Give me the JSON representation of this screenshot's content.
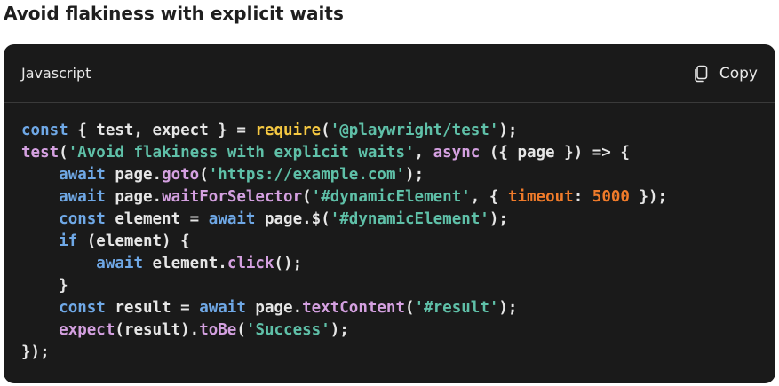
{
  "heading": "Avoid flakiness with explicit waits",
  "code_block": {
    "language": "Javascript",
    "copy_label": "Copy",
    "copy_icon": "copy-icon",
    "lines": [
      [
        {
          "t": "const",
          "c": "k"
        },
        {
          "t": " { test, expect } = "
        },
        {
          "t": "require",
          "c": "y"
        },
        {
          "t": "("
        },
        {
          "t": "'@playwright/test'",
          "c": "s"
        },
        {
          "t": ");"
        }
      ],
      [
        {
          "t": "test",
          "c": "f"
        },
        {
          "t": "("
        },
        {
          "t": "'Avoid flakiness with explicit waits'",
          "c": "s"
        },
        {
          "t": ", "
        },
        {
          "t": "async",
          "c": "f"
        },
        {
          "t": " ({ page }) => {"
        }
      ],
      [
        {
          "t": "    "
        },
        {
          "t": "await",
          "c": "k"
        },
        {
          "t": " page."
        },
        {
          "t": "goto",
          "c": "f"
        },
        {
          "t": "("
        },
        {
          "t": "'https://example.com'",
          "c": "s"
        },
        {
          "t": ");"
        }
      ],
      [
        {
          "t": "    "
        },
        {
          "t": "await",
          "c": "k"
        },
        {
          "t": " page."
        },
        {
          "t": "waitForSelector",
          "c": "f"
        },
        {
          "t": "("
        },
        {
          "t": "'#dynamicElement'",
          "c": "s"
        },
        {
          "t": ", { "
        },
        {
          "t": "timeout",
          "c": "n"
        },
        {
          "t": ": "
        },
        {
          "t": "5000",
          "c": "n"
        },
        {
          "t": " });"
        }
      ],
      [
        {
          "t": "    "
        },
        {
          "t": "const",
          "c": "k"
        },
        {
          "t": " element = "
        },
        {
          "t": "await",
          "c": "k"
        },
        {
          "t": " page.$("
        },
        {
          "t": "'#dynamicElement'",
          "c": "s"
        },
        {
          "t": ");"
        }
      ],
      [
        {
          "t": "    "
        },
        {
          "t": "if",
          "c": "k"
        },
        {
          "t": " (element) {"
        }
      ],
      [
        {
          "t": "        "
        },
        {
          "t": "await",
          "c": "k"
        },
        {
          "t": " element."
        },
        {
          "t": "click",
          "c": "f"
        },
        {
          "t": "();"
        }
      ],
      [
        {
          "t": "    }"
        }
      ],
      [
        {
          "t": "    "
        },
        {
          "t": "const",
          "c": "k"
        },
        {
          "t": " result = "
        },
        {
          "t": "await",
          "c": "k"
        },
        {
          "t": " page."
        },
        {
          "t": "textContent",
          "c": "f"
        },
        {
          "t": "("
        },
        {
          "t": "'#result'",
          "c": "s"
        },
        {
          "t": ");"
        }
      ],
      [
        {
          "t": "    "
        },
        {
          "t": "expect",
          "c": "f"
        },
        {
          "t": "(result)."
        },
        {
          "t": "toBe",
          "c": "f"
        },
        {
          "t": "("
        },
        {
          "t": "'Success'",
          "c": "s"
        },
        {
          "t": ");"
        }
      ],
      [
        {
          "t": "});"
        }
      ]
    ]
  },
  "colors": {
    "keyword": "#6fa8e6",
    "function": "#d4a0e0",
    "string": "#5fc0a8",
    "number": "#f07b2a",
    "builtin": "#f5c842",
    "card_background": "#1a1a1a"
  }
}
